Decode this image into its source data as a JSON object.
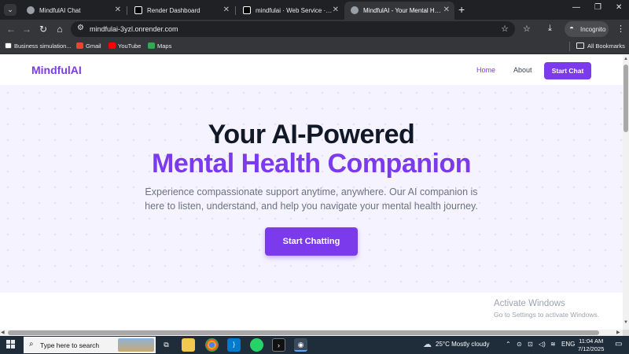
{
  "browser": {
    "tabs": [
      {
        "title": "MindfulAI Chat",
        "active": false
      },
      {
        "title": "Render Dashboard",
        "active": false
      },
      {
        "title": "mindfulai · Web Service · Rend",
        "active": false
      },
      {
        "title": "MindfulAI - Your Mental Health",
        "active": true
      }
    ],
    "url": "mindfulai-3yzl.onrender.com",
    "incognito_label": "Incognito",
    "bookmarks": [
      "Business simulation...",
      "Gmail",
      "YouTube",
      "Maps"
    ],
    "all_bookmarks_label": "All Bookmarks"
  },
  "site": {
    "logo": "MindfulAI",
    "nav": {
      "home": "Home",
      "about": "About",
      "cta": "Start Chat"
    },
    "hero": {
      "line1": "Your AI-Powered",
      "line2": "Mental Health Companion",
      "subtitle": "Experience compassionate support anytime, anywhere. Our AI companion is here to listen, understand, and help you navigate your mental health journey.",
      "cta": "Start Chatting"
    },
    "colors": {
      "accent": "#7c3aed",
      "hero_bg": "#f5f3ff",
      "heading": "#111827"
    }
  },
  "watermark": {
    "title": "Activate Windows",
    "subtitle": "Go to Settings to activate Windows."
  },
  "taskbar": {
    "search_placeholder": "Type here to search",
    "apps": [
      "task-view-icon",
      "file-explorer-icon",
      "chrome-icon",
      "vscode-icon",
      "whatsapp-icon",
      "terminal-icon",
      "chrome-active-icon"
    ],
    "weather": "25°C  Mostly cloudy",
    "language": "ENG",
    "time": "11:04 AM",
    "date": "7/12/2025"
  }
}
